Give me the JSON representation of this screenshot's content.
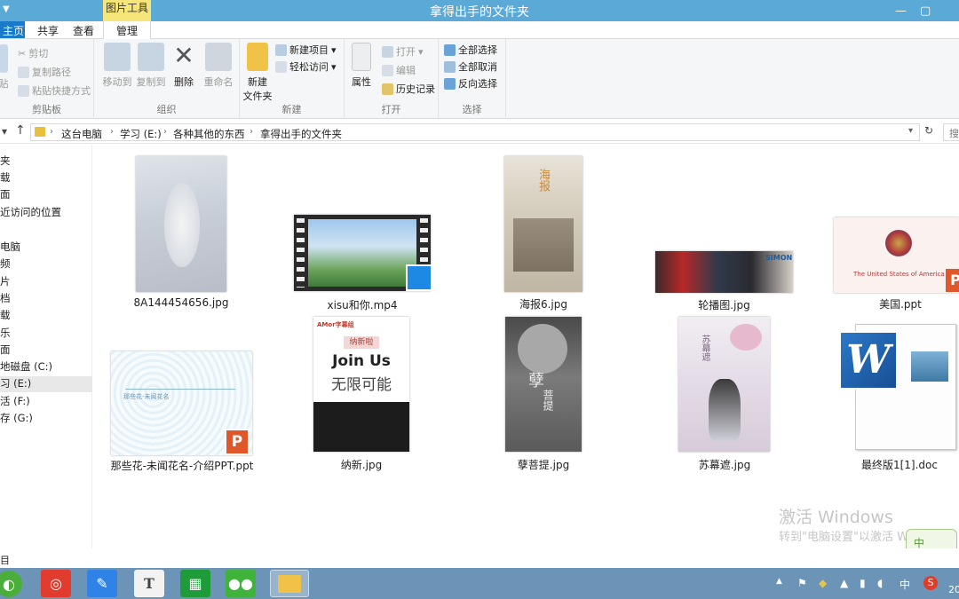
{
  "window": {
    "title": "拿得出手的文件夹",
    "contextual_tab": "图片工具"
  },
  "ribbon_tabs": [
    "主页",
    "共享",
    "查看",
    "管理"
  ],
  "file_tab": "主页",
  "ribbon": {
    "clipboard": {
      "label": "剪贴板",
      "cut": "剪切",
      "copy_path": "复制路径",
      "paste_shortcut": "粘贴快捷方式",
      "paste": "贴"
    },
    "organize": {
      "label": "组织",
      "move_to": "移动到",
      "copy_to": "复制到",
      "delete": "删除",
      "rename": "重命名"
    },
    "new": {
      "label": "新建",
      "new_item": "新建项目",
      "easy_access": "轻松访问",
      "new_folder_l1": "新建",
      "new_folder_l2": "文件夹"
    },
    "open": {
      "label": "打开",
      "properties": "属性",
      "open": "打开",
      "edit": "编辑",
      "history": "历史记录"
    },
    "select": {
      "label": "选择",
      "select_all": "全部选择",
      "select_none": "全部取消",
      "invert": "反向选择"
    }
  },
  "address": {
    "crumbs": [
      "这台电脑",
      "学习 (E:)",
      "各种其他的东西",
      "拿得出手的文件夹"
    ],
    "search_placeholder": "搜"
  },
  "nav_pane": {
    "items": [
      "夹",
      "载",
      "面",
      "近访问的位置",
      "电脑",
      "频",
      "片",
      "档",
      "载",
      "乐",
      "面",
      "地磁盘 (C:)",
      "习 (E:)",
      "活 (F:)",
      "存 (G:)"
    ],
    "selected_index": 12
  },
  "files": [
    {
      "name": "8A144454656.jpg",
      "kind": "image"
    },
    {
      "name": "xisu和你.mp4",
      "kind": "video"
    },
    {
      "name": "海报6.jpg",
      "kind": "image"
    },
    {
      "name": "轮播图.jpg",
      "kind": "image"
    },
    {
      "name": "美国.ppt",
      "kind": "ppt"
    },
    {
      "name": "那些花-未闻花名-介绍PPT.ppt",
      "kind": "ppt"
    },
    {
      "name": "纳新.jpg",
      "kind": "image"
    },
    {
      "name": "孽菩提.jpg",
      "kind": "image"
    },
    {
      "name": "苏幕遮.jpg",
      "kind": "image"
    },
    {
      "name": "最终版1[1].doc",
      "kind": "doc"
    }
  ],
  "thumb_text": {
    "join_brand": "AMor字幕组",
    "join_tag": "纳新啦",
    "join_title": "Join Us",
    "join_sub": "无限可能",
    "us_caption": "The United States of America",
    "nie_title": "孽",
    "nie_sub": "菩提",
    "su_title": "苏幕遮",
    "flower_text": "那些花-未闻花名",
    "carousel_text": "SIMON",
    "poster_text": "海报"
  },
  "watermark": {
    "line1": "激活 Windows",
    "line2": "转到\"电脑设置\"以激活 Windows。"
  },
  "status": {
    "count_text": "目"
  },
  "taskbar": {
    "apps": [
      "start",
      "netease-music",
      "pen-app",
      "typora",
      "store",
      "wechat",
      "file-explorer"
    ],
    "tray_ime": "中",
    "tray_year": "20"
  },
  "colors": {
    "title_bar": "#5aa9d6",
    "taskbar": "#6b94b6",
    "file_tab": "#1979ca",
    "context_tab": "#f6e67a"
  }
}
